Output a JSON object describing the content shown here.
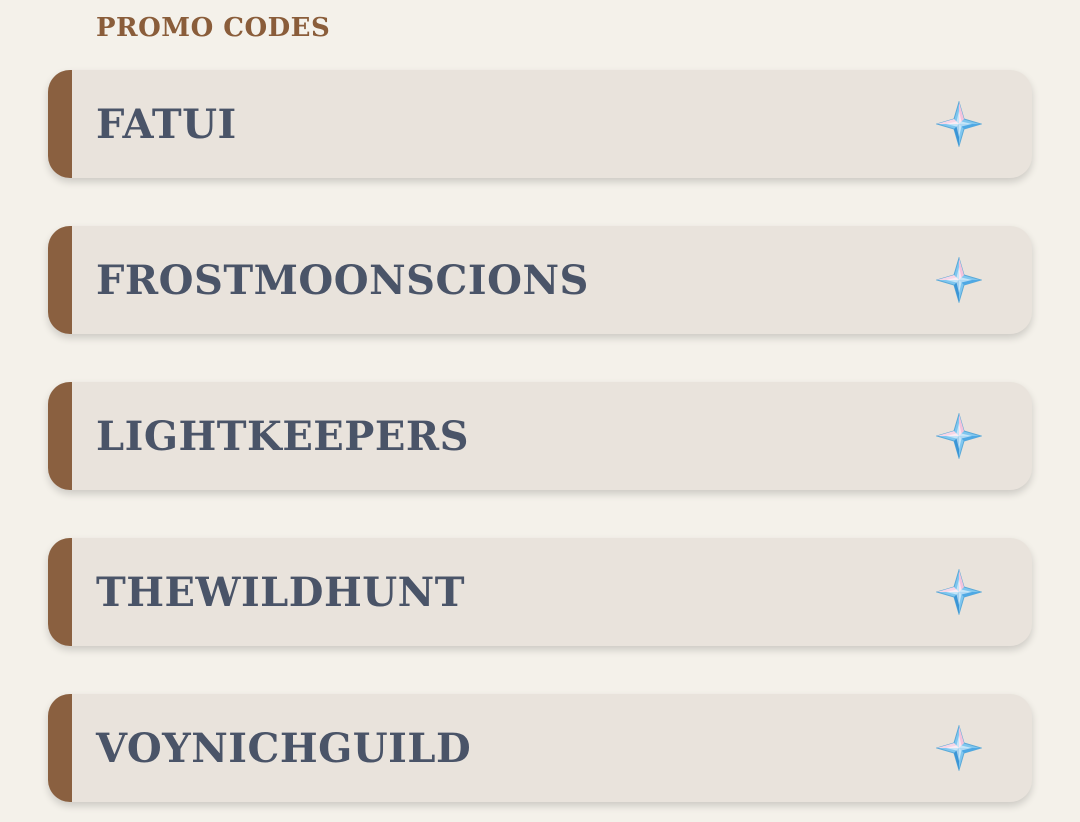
{
  "section": {
    "title": "PROMO CODES"
  },
  "codes": [
    {
      "code": "FATUI",
      "icon": "primogem-icon"
    },
    {
      "code": "FROSTMOONSCIONS",
      "icon": "primogem-icon"
    },
    {
      "code": "LIGHTKEEPERS",
      "icon": "primogem-icon"
    },
    {
      "code": "THEWILDHUNT",
      "icon": "primogem-icon"
    },
    {
      "code": "VOYNICHGUILD",
      "icon": "primogem-icon"
    }
  ],
  "colors": {
    "background": "#f4f1ea",
    "card": "#e9e3dc",
    "accent": "#8a6040",
    "title": "#8a5d3a",
    "code_text": "#4a5468"
  }
}
